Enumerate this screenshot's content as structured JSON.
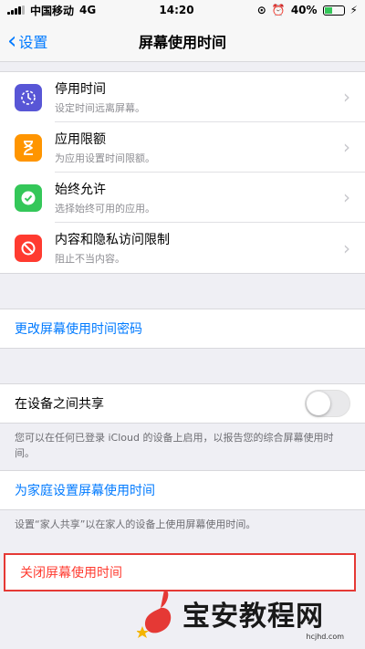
{
  "status_bar": {
    "carrier": "中国移动",
    "network": "4G",
    "time": "14:20",
    "battery": "40%"
  },
  "nav": {
    "back_label": "设置",
    "title": "屏幕使用时间"
  },
  "features": [
    {
      "title": "停用时间",
      "subtitle": "设定时间远离屏幕。",
      "icon": "downtime-icon",
      "color": "#5856d6"
    },
    {
      "title": "应用限额",
      "subtitle": "为应用设置时间限额。",
      "icon": "hourglass-icon",
      "color": "#ff9500"
    },
    {
      "title": "始终允许",
      "subtitle": "选择始终可用的应用。",
      "icon": "checkmark-icon",
      "color": "#34c759"
    },
    {
      "title": "内容和隐私访问限制",
      "subtitle": "阻止不当内容。",
      "icon": "restriction-icon",
      "color": "#ff3b30"
    }
  ],
  "change_passcode": "更改屏幕使用时间密码",
  "share": {
    "label": "在设备之间共享",
    "enabled": false,
    "footnote": "您可以在任何已登录 iCloud 的设备上启用，以报告您的综合屏幕使用时间。"
  },
  "family": {
    "label": "为家庭设置屏幕使用时间",
    "footnote": "设置“家人共享”以在家人的设备上使用屏幕使用时间。"
  },
  "turn_off": "关闭屏幕使用时间",
  "watermark": {
    "text": "宝安教程网",
    "url": "hcjhd.com"
  }
}
